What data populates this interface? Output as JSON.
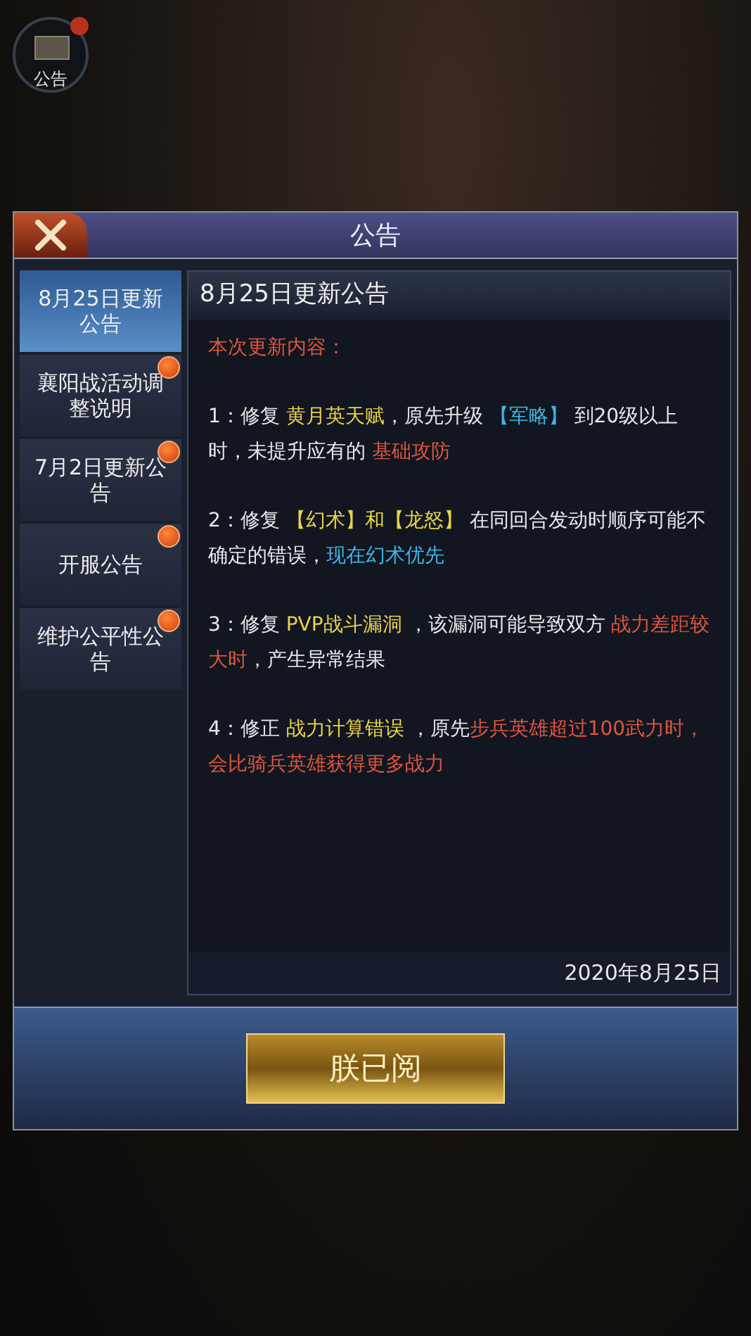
{
  "corner_button": {
    "label": "公告",
    "badge": true
  },
  "dialog": {
    "title": "公告",
    "tabs": [
      {
        "label": "8月25日更新公告",
        "selected": true,
        "badge": false
      },
      {
        "label": "襄阳战活动调整说明",
        "selected": false,
        "badge": true
      },
      {
        "label": "7月2日更新公告",
        "selected": false,
        "badge": true
      },
      {
        "label": "开服公告",
        "selected": false,
        "badge": true
      },
      {
        "label": "维护公平性公告",
        "selected": false,
        "badge": true
      }
    ],
    "content": {
      "heading": "8月25日更新公告",
      "paragraphs": [
        [
          {
            "text": "本次更新内容：",
            "kind": "red"
          }
        ],
        [
          {
            "text": " 1：修复 ",
            "kind": "plain"
          },
          {
            "text": "黄月英天赋",
            "kind": "yellow"
          },
          {
            "text": "，原先升级 ",
            "kind": "plain"
          },
          {
            "text": "【军略】",
            "kind": "blue"
          },
          {
            "text": " 到20级以上时，未提升应有的 ",
            "kind": "plain"
          },
          {
            "text": "基础攻防",
            "kind": "red"
          }
        ],
        [
          {
            "text": "2：修复 ",
            "kind": "plain"
          },
          {
            "text": "【幻术】和【龙怒】",
            "kind": "yellow"
          },
          {
            "text": " 在同回合发动时顺序可能不确定的错误，",
            "kind": "plain"
          },
          {
            "text": "现在幻术优先",
            "kind": "blue"
          }
        ],
        [
          {
            "text": "3：修复 ",
            "kind": "plain"
          },
          {
            "text": "PVP战斗漏洞",
            "kind": "yellow"
          },
          {
            "text": " ，该漏洞可能导致双方 ",
            "kind": "plain"
          },
          {
            "text": "战力差距较大时",
            "kind": "red"
          },
          {
            "text": "，产生异常结果",
            "kind": "plain"
          }
        ],
        [
          {
            "text": "4：修正 ",
            "kind": "plain"
          },
          {
            "text": "战力计算错误",
            "kind": "yellow"
          },
          {
            "text": " ，原先",
            "kind": "plain"
          },
          {
            "text": "步兵英雄超过100武力时，会比骑兵英雄获得更多战力",
            "kind": "red"
          }
        ]
      ],
      "date": "2020年8月25日"
    },
    "confirm_button": "朕已阅"
  }
}
